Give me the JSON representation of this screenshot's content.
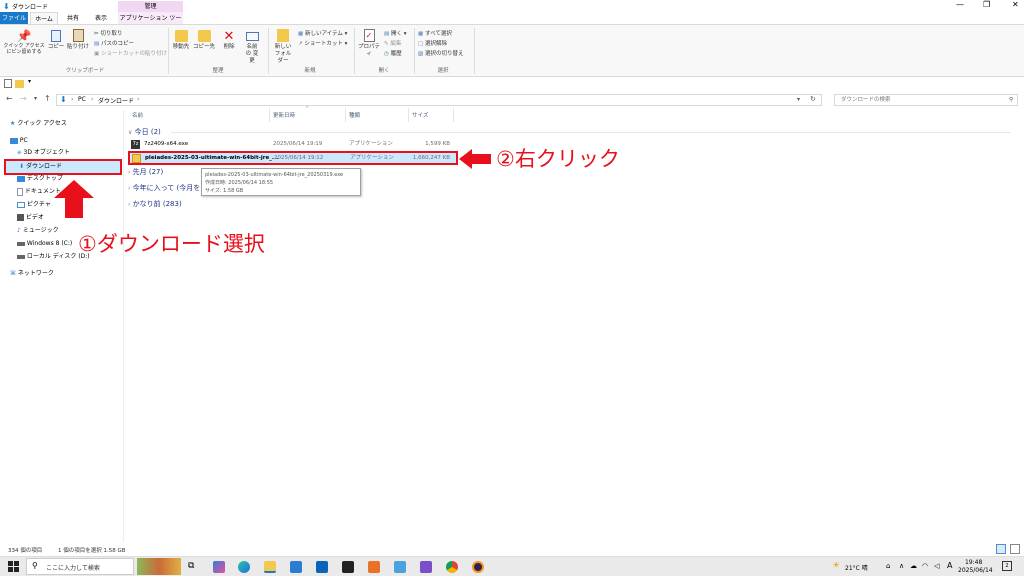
{
  "window": {
    "title": "ダウンロード",
    "controls": [
      "minimize-icon",
      "maximize-icon",
      "close-icon"
    ]
  },
  "ribbon": {
    "context_tab_header": "管理",
    "tabs": [
      {
        "label": "ファイル"
      },
      {
        "label": "ホーム"
      },
      {
        "label": "共有"
      },
      {
        "label": "表示"
      },
      {
        "label": "アプリケーション ツール"
      }
    ],
    "clipboard": {
      "pin": "クイック アクセス にピン留めする",
      "copy": "コピー",
      "paste": "貼り付け",
      "cut": "切り取り",
      "copy_path": "パスのコピー",
      "paste_shortcut": "ショートカットの貼り付け",
      "label": "クリップボード"
    },
    "organize": {
      "move": "移動先",
      "copy_to": "コピー先",
      "delete": "削除",
      "rename": "名前の 変更",
      "label": "整理"
    },
    "new": {
      "folder": "新しい フォルダー",
      "new_item": "新しいアイテム",
      "shortcut": "ショートカット",
      "label": "新規"
    },
    "open": {
      "properties": "プロパティ",
      "open": "開く",
      "edit": "編集",
      "history": "履歴",
      "label": "開く"
    },
    "select": {
      "all": "すべて選択",
      "none": "選択解除",
      "invert": "選択の切り替え",
      "label": "選択"
    }
  },
  "address": {
    "path": [
      "PC",
      "ダウンロード"
    ],
    "search_placeholder": "ダウンロードの検索"
  },
  "nav": {
    "items": [
      {
        "label": "クイック アクセス",
        "icon": "star-icon",
        "color": "#2f7fd8"
      },
      {
        "label": "PC",
        "icon": "pc-icon",
        "color": "#3a88d6"
      },
      {
        "label": "3D オブジェクト",
        "icon": "cube-icon",
        "color": "#5fb1e6"
      },
      {
        "label": "ダウンロード",
        "icon": "download-icon",
        "color": "#2b78d4"
      },
      {
        "label": "デスクトップ",
        "icon": "desktop-icon",
        "color": "#2f8be0"
      },
      {
        "label": "ドキュメント",
        "icon": "document-icon",
        "color": "#8a97a8"
      },
      {
        "label": "ピクチャ",
        "icon": "picture-icon",
        "color": "#4b8fcf"
      },
      {
        "label": "ビデオ",
        "icon": "video-icon",
        "color": "#555"
      },
      {
        "label": "ミュージック",
        "icon": "music-icon",
        "color": "#2f7fd8"
      },
      {
        "label": "Windows 8 (C:)",
        "icon": "drive-icon",
        "color": "#666"
      },
      {
        "label": "ローカル ディスク (D:)",
        "icon": "drive-icon",
        "color": "#666"
      },
      {
        "label": "ネットワーク",
        "icon": "network-icon",
        "color": "#2f7fd8"
      }
    ]
  },
  "columns": {
    "name": "名前",
    "date": "更新日時",
    "type": "種類",
    "size": "サイズ"
  },
  "groups": {
    "today": "今日 (2)",
    "last_month": "先月 (27)",
    "this_year": "今年に入って (今月を",
    "long_ago": "かなり前 (283)"
  },
  "files": [
    {
      "name": "7z2409-x64.exe",
      "date": "2025/06/14 19:19",
      "type": "アプリケーション",
      "size": "1,599 KB",
      "icon": "7zip-icon"
    },
    {
      "name": "pleiades-2025-03-ultimate-win-64bit-jre_...",
      "date": "2025/06/14 19:12",
      "type": "アプリケーション",
      "size": "1,660,247 KB",
      "icon": "zip-icon"
    }
  ],
  "tooltip": {
    "line1": "pleiades-2025-03-ultimate-win-64bit-jre_20250319.exe",
    "line2": "作成日時: 2025/06/14 18:55",
    "line3": "サイズ: 1.58 GB"
  },
  "annotations": {
    "step1": "①ダウンロード選択",
    "step2": "②右クリック"
  },
  "status": {
    "count": "334 個の項目",
    "selected": "1 個の項目を選択 1.58 GB"
  },
  "taskbar": {
    "search_placeholder": "ここに入力して検索",
    "weather": "21°C 晴",
    "ime": "A",
    "time": "19:48",
    "date": "2025/06/14",
    "notif": "2"
  },
  "colors": {
    "accent": "#1979ca",
    "selection": "#cce8ff",
    "annotation": "#e8101a"
  }
}
